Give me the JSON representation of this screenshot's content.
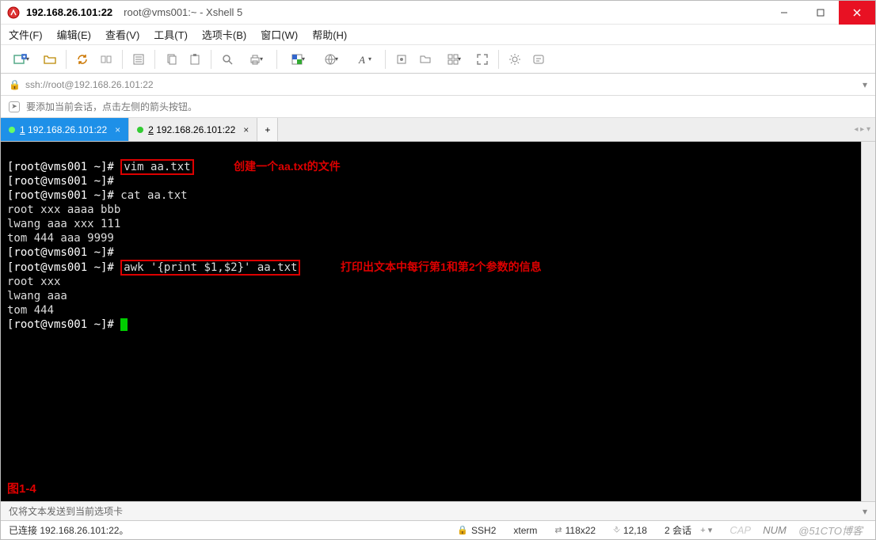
{
  "titlebar": {
    "address": "192.168.26.101:22",
    "subtitle": "root@vms001:~ - Xshell 5"
  },
  "menu": {
    "file": "文件(F)",
    "edit": "编辑(E)",
    "view": "查看(V)",
    "tools": "工具(T)",
    "tabs": "选项卡(B)",
    "window": "窗口(W)",
    "help": "帮助(H)"
  },
  "address": {
    "url": "ssh://root@192.168.26.101:22"
  },
  "infobar": {
    "hint": "要添加当前会话，点击左侧的箭头按钮。"
  },
  "tabs": {
    "active": {
      "num": "1",
      "label": "192.168.26.101:22"
    },
    "inactive": {
      "num": "2",
      "label": "192.168.26.101:22"
    },
    "add": "+"
  },
  "terminal": {
    "prompt": "[root@vms001 ~]#",
    "cmd1": "vim aa.txt",
    "annot1": "创建一个aa.txt的文件",
    "cmd_cat": "cat aa.txt",
    "out1": "root xxx aaaa bbb",
    "out2": "lwang aaa xxx 111",
    "out3": "tom 444 aaa 9999",
    "cmd2": "awk '{print $1,$2}' aa.txt",
    "annot2": "打印出文本中每行第1和第2个参数的信息",
    "res1": "root xxx",
    "res2": "lwang aaa",
    "res3": "tom 444",
    "figlabel": "图1-4"
  },
  "sendbar": {
    "placeholder": "仅将文本发送到当前选项卡"
  },
  "status": {
    "connected": "已连接 192.168.26.101:22。",
    "ssh": "SSH2",
    "term": "xterm",
    "size": "118x22",
    "cursor": "12,18",
    "sessions": "2 会话",
    "caps": "CAP",
    "num": "NUM",
    "watermark": "@51CTO博客",
    "size_arrows": "⇄",
    "cursor_icon": "⎀",
    "lock": "🔒",
    "plus": "+ ▾"
  }
}
